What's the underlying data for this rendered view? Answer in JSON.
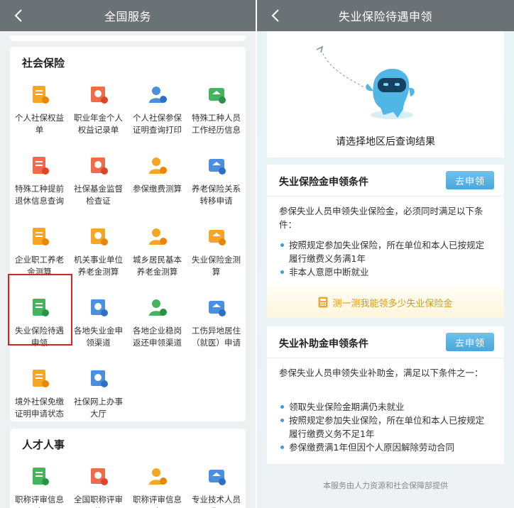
{
  "left": {
    "title": "全国服务",
    "social": {
      "title": "社会保险",
      "items": [
        {
          "label": "个人社保权益单",
          "icon": "document-list-icon"
        },
        {
          "label": "职业年金个人权益记录单",
          "icon": "pension-record-icon"
        },
        {
          "label": "个人社保参保证明查询打印",
          "icon": "certificate-print-icon"
        },
        {
          "label": "特殊工种人员工作经历信息",
          "icon": "worker-info-icon"
        },
        {
          "label": "特殊工种提前退休信息查询",
          "icon": "early-retire-icon"
        },
        {
          "label": "社保基金监督检查证",
          "icon": "id-card-icon"
        },
        {
          "label": "参保缴费测算",
          "icon": "payment-calc-icon"
        },
        {
          "label": "养老保险关系转移申请",
          "icon": "transfer-icon"
        },
        {
          "label": "企业职工养老金测算",
          "icon": "employee-pension-icon"
        },
        {
          "label": "机关事业单位养老金测算",
          "icon": "institution-building-icon"
        },
        {
          "label": "城乡居民基本养老金测算",
          "icon": "resident-pension-icon"
        },
        {
          "label": "失业保险金测算",
          "icon": "unemployment-calc-icon"
        },
        {
          "label": "失业保险待遇申领",
          "icon": "unemployment-benefit-icon"
        },
        {
          "label": "各地失业金申领渠道",
          "icon": "yuan-channel-icon"
        },
        {
          "label": "各地企业稳岗返还申领渠道",
          "icon": "tie-refund-icon"
        },
        {
          "label": "工伤异地居住（就医）申请",
          "icon": "injury-application-icon"
        },
        {
          "label": "境外社保免缴证明申请状态",
          "icon": "globe-certificate-icon"
        },
        {
          "label": "社保网上办事大厅",
          "icon": "online-hall-icon"
        }
      ]
    },
    "talent": {
      "title": "人才人事",
      "items": [
        {
          "label": "职称评审信息查",
          "icon": "title-review-icon"
        },
        {
          "label": "全国职称评审信",
          "icon": "national-review-icon"
        },
        {
          "label": "职称评审信息查",
          "icon": "review-query-icon"
        },
        {
          "label": "专业技术人员职",
          "icon": "professional-shield-icon"
        }
      ]
    }
  },
  "right": {
    "title": "失业保险待遇申领",
    "prompt": "请选择地区后查询结果",
    "cards": [
      {
        "title": "失业保险金申领条件",
        "button": "去申领",
        "desc": "参保失业人员申领失业保险金，必须同时满足以下条件：",
        "bullets": [
          "按照规定参加失业保险，所在单位和本人已按规定履行缴费义务满1年",
          "非本人意愿中断就业"
        ],
        "calc": "测一测我能领多少失业保险金"
      },
      {
        "title": "失业补助金申领条件",
        "button": "去申领",
        "desc": "参保失业人员申领失业补助金，满足以下条件之一：",
        "bullets": [
          "领取失业保险金期满仍未就业",
          "按照规定参加失业保险，所在单位和本人已按规定履行缴费义务不足1年",
          "参保缴费满1年但因个人原因解除劳动合同"
        ]
      }
    ],
    "footer": "本服务由人力资源和社会保障部提供"
  },
  "colors": {
    "navbar": "#6b7275",
    "orange": "#f39c1e",
    "red": "#e85a3c",
    "blue": "#3b82d6",
    "green": "#3aa856",
    "button_blue": "#4aa8dc",
    "highlight_red": "#d92323"
  }
}
